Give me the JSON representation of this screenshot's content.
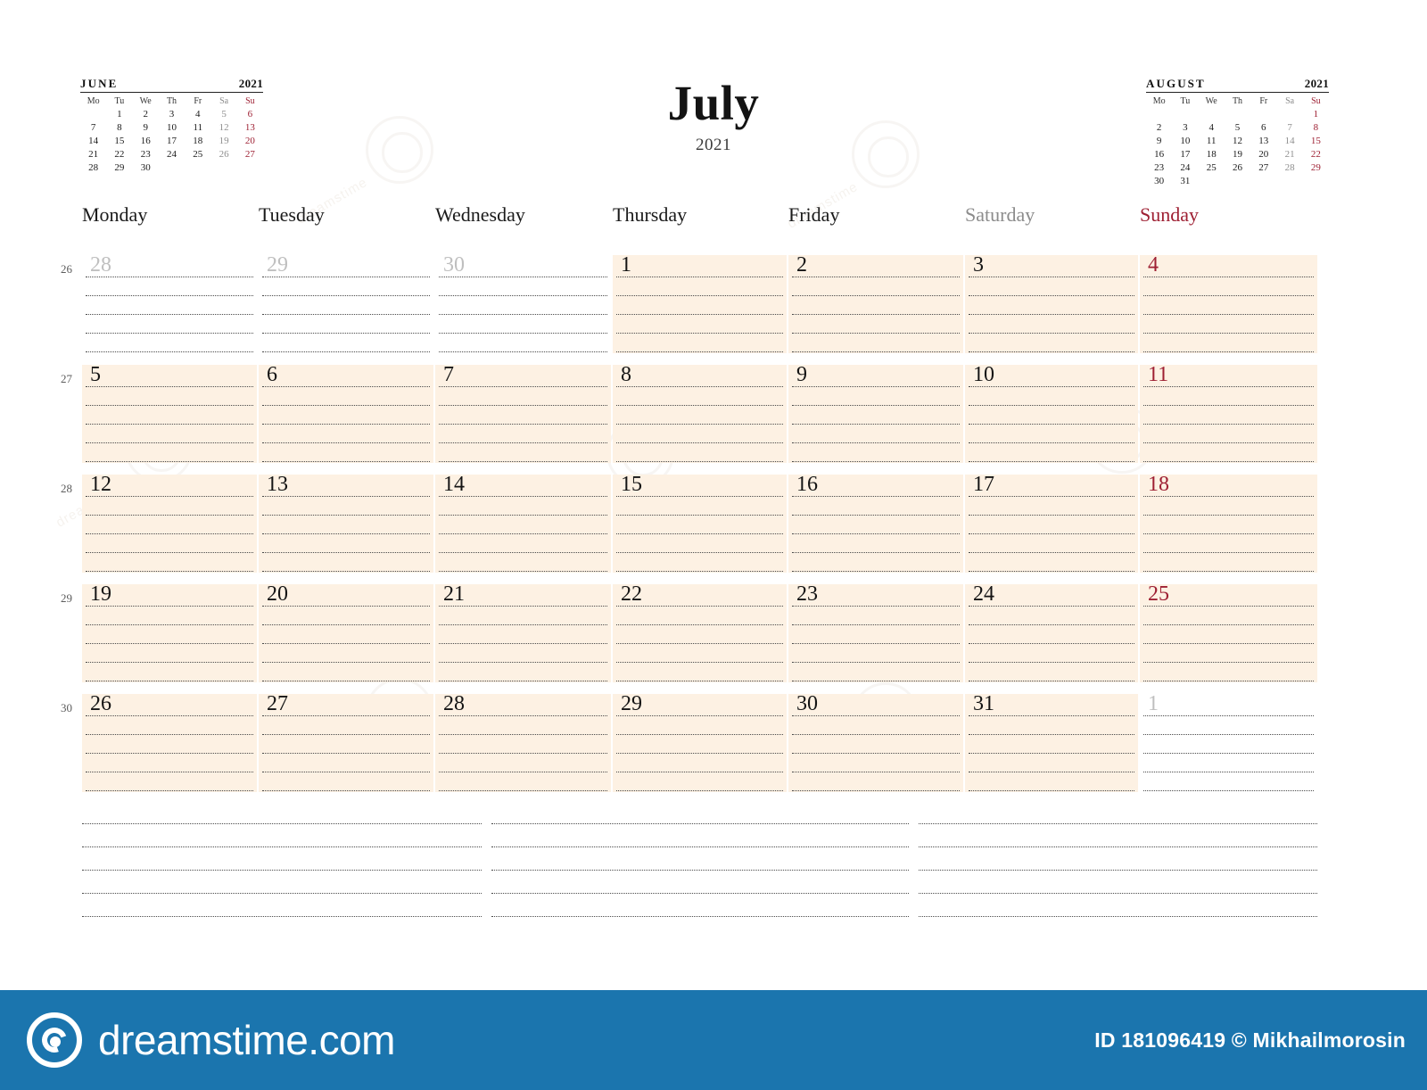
{
  "title": {
    "month": "July",
    "year": "2021"
  },
  "mini_calendars": [
    {
      "name": "june-mini-calendar",
      "month": "JUNE",
      "year": "2021",
      "dow": [
        "Mo",
        "Tu",
        "We",
        "Th",
        "Fr",
        "Sa",
        "Su"
      ],
      "weeks": [
        [
          "",
          "1",
          "2",
          "3",
          "4",
          "5",
          "6"
        ],
        [
          "7",
          "8",
          "9",
          "10",
          "11",
          "12",
          "13"
        ],
        [
          "14",
          "15",
          "16",
          "17",
          "18",
          "19",
          "20"
        ],
        [
          "21",
          "22",
          "23",
          "24",
          "25",
          "26",
          "27"
        ],
        [
          "28",
          "29",
          "30",
          "",
          "",
          "",
          ""
        ]
      ]
    },
    {
      "name": "august-mini-calendar",
      "month": "AUGUST",
      "year": "2021",
      "dow": [
        "Mo",
        "Tu",
        "We",
        "Th",
        "Fr",
        "Sa",
        "Su"
      ],
      "weeks": [
        [
          "",
          "",
          "",
          "",
          "",
          "",
          "1"
        ],
        [
          "2",
          "3",
          "4",
          "5",
          "6",
          "7",
          "8"
        ],
        [
          "9",
          "10",
          "11",
          "12",
          "13",
          "14",
          "15"
        ],
        [
          "16",
          "17",
          "18",
          "19",
          "20",
          "21",
          "22"
        ],
        [
          "23",
          "24",
          "25",
          "26",
          "27",
          "28",
          "29"
        ],
        [
          "30",
          "31",
          "",
          "",
          "",
          "",
          ""
        ]
      ]
    }
  ],
  "weekday_headers": [
    "Monday",
    "Tuesday",
    "Wednesday",
    "Thursday",
    "Friday",
    "Saturday",
    "Sunday"
  ],
  "week_numbers": [
    "26",
    "27",
    "28",
    "29",
    "30"
  ],
  "weeks": [
    [
      {
        "day": "28",
        "out": true,
        "hl": false
      },
      {
        "day": "29",
        "out": true,
        "hl": false
      },
      {
        "day": "30",
        "out": true,
        "hl": false
      },
      {
        "day": "1",
        "out": false,
        "hl": true
      },
      {
        "day": "2",
        "out": false,
        "hl": true
      },
      {
        "day": "3",
        "out": false,
        "hl": true
      },
      {
        "day": "4",
        "out": false,
        "hl": true,
        "sun": true
      }
    ],
    [
      {
        "day": "5",
        "out": false,
        "hl": true
      },
      {
        "day": "6",
        "out": false,
        "hl": true
      },
      {
        "day": "7",
        "out": false,
        "hl": true
      },
      {
        "day": "8",
        "out": false,
        "hl": true
      },
      {
        "day": "9",
        "out": false,
        "hl": true
      },
      {
        "day": "10",
        "out": false,
        "hl": true
      },
      {
        "day": "11",
        "out": false,
        "hl": true,
        "sun": true
      }
    ],
    [
      {
        "day": "12",
        "out": false,
        "hl": true
      },
      {
        "day": "13",
        "out": false,
        "hl": true
      },
      {
        "day": "14",
        "out": false,
        "hl": true
      },
      {
        "day": "15",
        "out": false,
        "hl": true
      },
      {
        "day": "16",
        "out": false,
        "hl": true
      },
      {
        "day": "17",
        "out": false,
        "hl": true
      },
      {
        "day": "18",
        "out": false,
        "hl": true,
        "sun": true
      }
    ],
    [
      {
        "day": "19",
        "out": false,
        "hl": true
      },
      {
        "day": "20",
        "out": false,
        "hl": true
      },
      {
        "day": "21",
        "out": false,
        "hl": true
      },
      {
        "day": "22",
        "out": false,
        "hl": true
      },
      {
        "day": "23",
        "out": false,
        "hl": true
      },
      {
        "day": "24",
        "out": false,
        "hl": true
      },
      {
        "day": "25",
        "out": false,
        "hl": true,
        "sun": true
      }
    ],
    [
      {
        "day": "26",
        "out": false,
        "hl": true
      },
      {
        "day": "27",
        "out": false,
        "hl": true
      },
      {
        "day": "28",
        "out": false,
        "hl": true
      },
      {
        "day": "29",
        "out": false,
        "hl": true
      },
      {
        "day": "30",
        "out": false,
        "hl": true
      },
      {
        "day": "31",
        "out": false,
        "hl": true
      },
      {
        "day": "1",
        "out": true,
        "hl": false,
        "sun": true
      }
    ]
  ],
  "notes": {
    "columns": 3,
    "lines_per_column": 5
  },
  "watermark": {
    "text": "dreamstime"
  },
  "footer": {
    "brand": "dreamstime.com",
    "credit": "ID 181096419 © Mikhailmorosin",
    "background": "#1b75ae"
  },
  "colors": {
    "highlight": "#fdf1e3",
    "sunday": "#9e2033",
    "saturday": "#8c8c8c",
    "out_of_month": "#bfbfbf",
    "text": "#141414"
  }
}
